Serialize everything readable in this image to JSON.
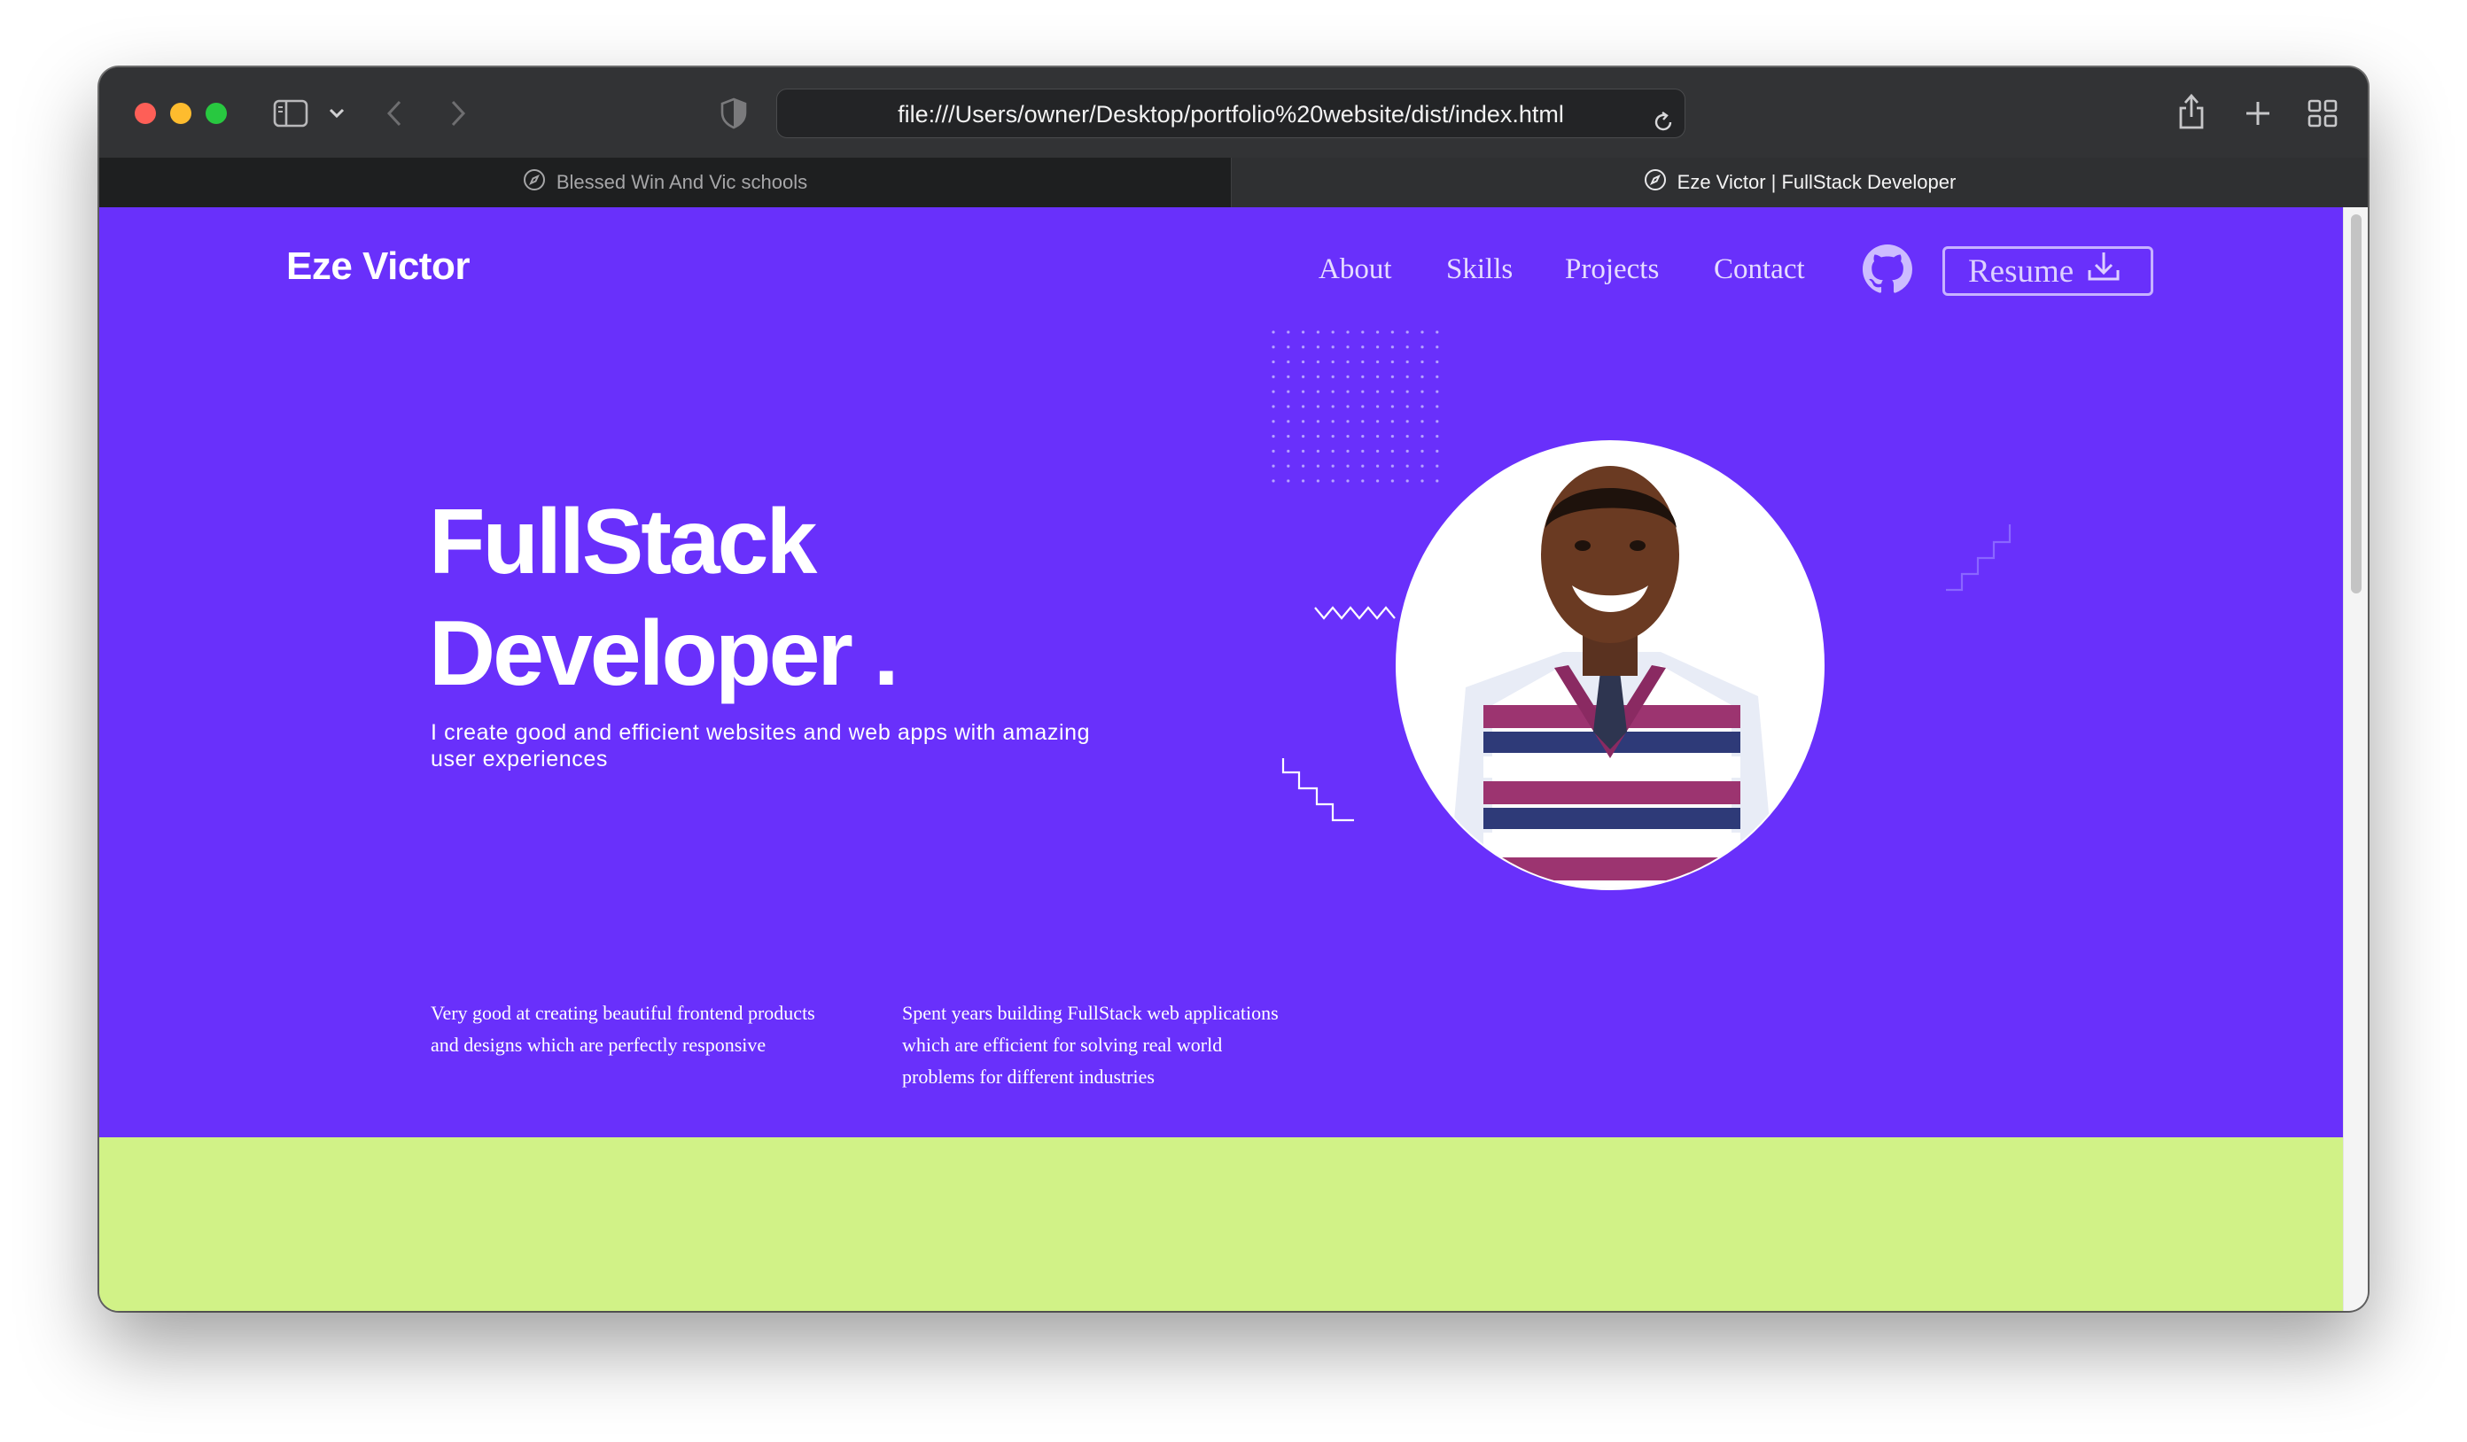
{
  "browser": {
    "address": "file:///Users/owner/Desktop/portfolio%20website/dist/index.html",
    "tabs": [
      {
        "title": "Blessed Win And Vic schools",
        "active": false
      },
      {
        "title": "Eze Victor | FullStack Developer",
        "active": true
      }
    ]
  },
  "site": {
    "brand": "Eze Victor",
    "nav": [
      "About",
      "Skills",
      "Projects",
      "Contact"
    ],
    "resume_label": "Resume",
    "hero": {
      "title_line1": "FullStack",
      "title_line2": "Developer .",
      "tagline": "I create good and efficient websites and web apps with amazing user experiences"
    },
    "features": [
      "Very good at creating beautiful frontend products and designs which are perfectly responsive",
      "Spent years building FullStack web applications which are efficient for solving real world problems for different industries"
    ]
  },
  "colors": {
    "hero_background": "#6930fb",
    "section_background": "#d1f287",
    "toolbar": "#323335",
    "text": "#ffffff"
  },
  "icons": [
    "sidebar-icon",
    "chevron-down-icon",
    "back-icon",
    "forward-icon",
    "shield-icon",
    "reload-icon",
    "share-icon",
    "plus-icon",
    "tab-overview-icon",
    "compass-icon",
    "github-icon",
    "download-icon"
  ]
}
